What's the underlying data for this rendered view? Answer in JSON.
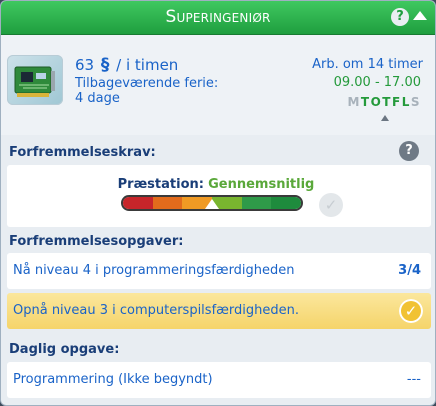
{
  "header": {
    "title": "Superingeniør",
    "help_icon": "?",
    "collapse_icon": "chevron-up-icon"
  },
  "job": {
    "pay_amount": "63",
    "pay_currency": "§",
    "pay_period": "/ i timen",
    "vacation_label": "Tilbageværende ferie:",
    "vacation_value": "4 dage",
    "work_in": "Arb. om 14 timer",
    "work_hours": "09.00 - 17.00",
    "days": [
      {
        "letter": "M",
        "active": false
      },
      {
        "letter": "T",
        "active": true
      },
      {
        "letter": "O",
        "active": true
      },
      {
        "letter": "T",
        "active": true
      },
      {
        "letter": "F",
        "active": true
      },
      {
        "letter": "L",
        "active": true
      },
      {
        "letter": "S",
        "active": false
      }
    ]
  },
  "promotion": {
    "label": "Forfremmelseskrav:",
    "help_icon": "?",
    "performance_label": "Præstation:",
    "performance_value": "Gennemsnitlig",
    "meter_colors": [
      "#c7252a",
      "#e26b1c",
      "#f09a24",
      "#79b52f",
      "#2f9a49",
      "#1e8b3d"
    ],
    "meter_level": 0.5
  },
  "promotion_tasks": {
    "label": "Forfremmelsesopgaver:",
    "items": [
      {
        "text": "Nå niveau 4 i programmeringsfærdigheden",
        "progress": "3/4",
        "done": false
      },
      {
        "text": "Opnå niveau 3 i computerspilsfærdigheden.",
        "progress": "",
        "done": true
      }
    ]
  },
  "daily_task": {
    "label": "Daglig opgave:",
    "text": "Programmering (Ikke begyndt)",
    "progress": "---"
  }
}
